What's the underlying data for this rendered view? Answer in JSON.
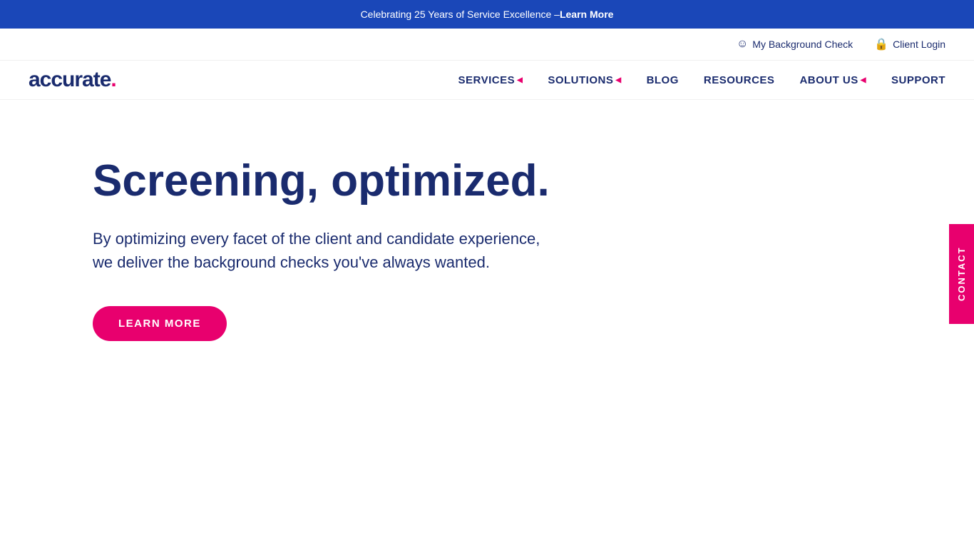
{
  "announcement": {
    "text": "Celebrating 25 Years of Service Excellence – ",
    "link_label": "Learn More"
  },
  "secondary_nav": {
    "my_background_check": {
      "label": "My Background Check",
      "icon": "person"
    },
    "client_login": {
      "label": "Client Login",
      "icon": "lock"
    }
  },
  "logo": {
    "text_main": "accurate",
    "dot": "."
  },
  "primary_nav": {
    "items": [
      {
        "label": "SERVICES",
        "has_dropdown": true
      },
      {
        "label": "SOLUTIONS",
        "has_dropdown": true
      },
      {
        "label": "BLOG",
        "has_dropdown": false
      },
      {
        "label": "RESOURCES",
        "has_dropdown": false
      },
      {
        "label": "ABOUT US",
        "has_dropdown": true
      },
      {
        "label": "SUPPORT",
        "has_dropdown": false
      }
    ]
  },
  "hero": {
    "title": "Screening, optimized.",
    "subtitle_line1": "By optimizing every facet of the client and candidate experience,",
    "subtitle_line2": "we deliver the background checks you've always wanted.",
    "cta_button": "LEARN MORE"
  },
  "contact_sidebar": {
    "label": "CONTACT"
  },
  "colors": {
    "brand_blue": "#1a2b6e",
    "brand_pink": "#e8006e",
    "bar_blue": "#1a47b8",
    "white": "#ffffff"
  }
}
